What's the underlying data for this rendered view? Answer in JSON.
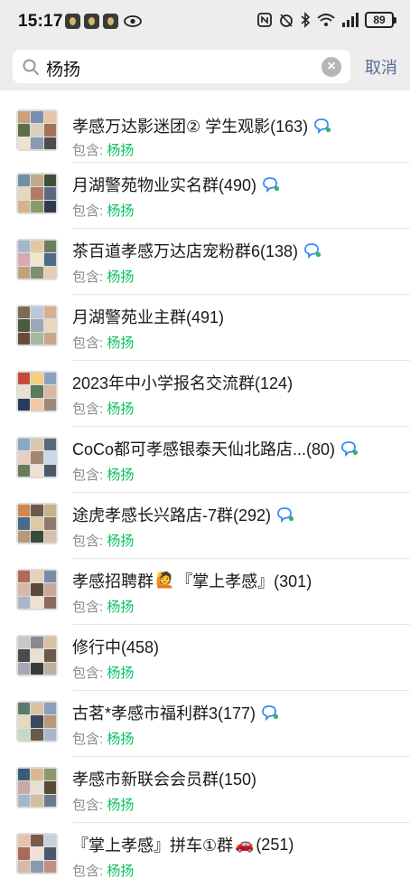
{
  "status_bar": {
    "time": "15:17",
    "battery": "89"
  },
  "search": {
    "query": "杨扬",
    "cancel_label": "取消"
  },
  "results": [
    {
      "title": "孝感万达影迷团② 学生观影(163)",
      "contains_label": "包含: ",
      "match": "杨扬",
      "has_badge": true
    },
    {
      "title": "月湖警苑物业实名群(490)",
      "contains_label": "包含: ",
      "match": "杨扬",
      "has_badge": true
    },
    {
      "title": "茶百道孝感万达店宠粉群6(138)",
      "contains_label": "包含: ",
      "match": "杨扬",
      "has_badge": true
    },
    {
      "title": "月湖警苑业主群(491)",
      "contains_label": "包含: ",
      "match": "杨扬",
      "has_badge": false
    },
    {
      "title": "2023年中小学报名交流群(124)",
      "contains_label": "包含: ",
      "match": "杨扬",
      "has_badge": false
    },
    {
      "title": "CoCo都可孝感银泰天仙北路店...(80)",
      "contains_label": "包含: ",
      "match": "杨扬",
      "has_badge": true
    },
    {
      "title": "途虎孝感长兴路店-7群(292)",
      "contains_label": "包含: ",
      "match": "杨扬",
      "has_badge": true
    },
    {
      "title_pre": "孝感招聘群",
      "title_post": "『掌上孝感』(301)",
      "contains_label": "包含: ",
      "match": "杨扬",
      "emoji": "🙋"
    },
    {
      "title": "修行中(458)",
      "contains_label": "包含: ",
      "match": "杨扬",
      "has_badge": false
    },
    {
      "title": "古茗*孝感市福利群3(177)",
      "contains_label": "包含: ",
      "match": "杨扬",
      "has_badge": true
    },
    {
      "title": "孝感市新联会会员群(150)",
      "contains_label": "包含: ",
      "match": "杨扬",
      "has_badge": false
    },
    {
      "title_pre": "『掌上孝感』拼车①群",
      "title_post": "(251)",
      "contains_label": "包含: ",
      "match": "杨扬",
      "emoji": "🚗"
    }
  ],
  "colors": {
    "highlight": "#07c160",
    "cancel": "#576b95",
    "badge": "#3d8bf2"
  },
  "icons": {
    "search": "search-icon",
    "clear": "clear-icon",
    "badge": "chat-bubble-icon"
  }
}
